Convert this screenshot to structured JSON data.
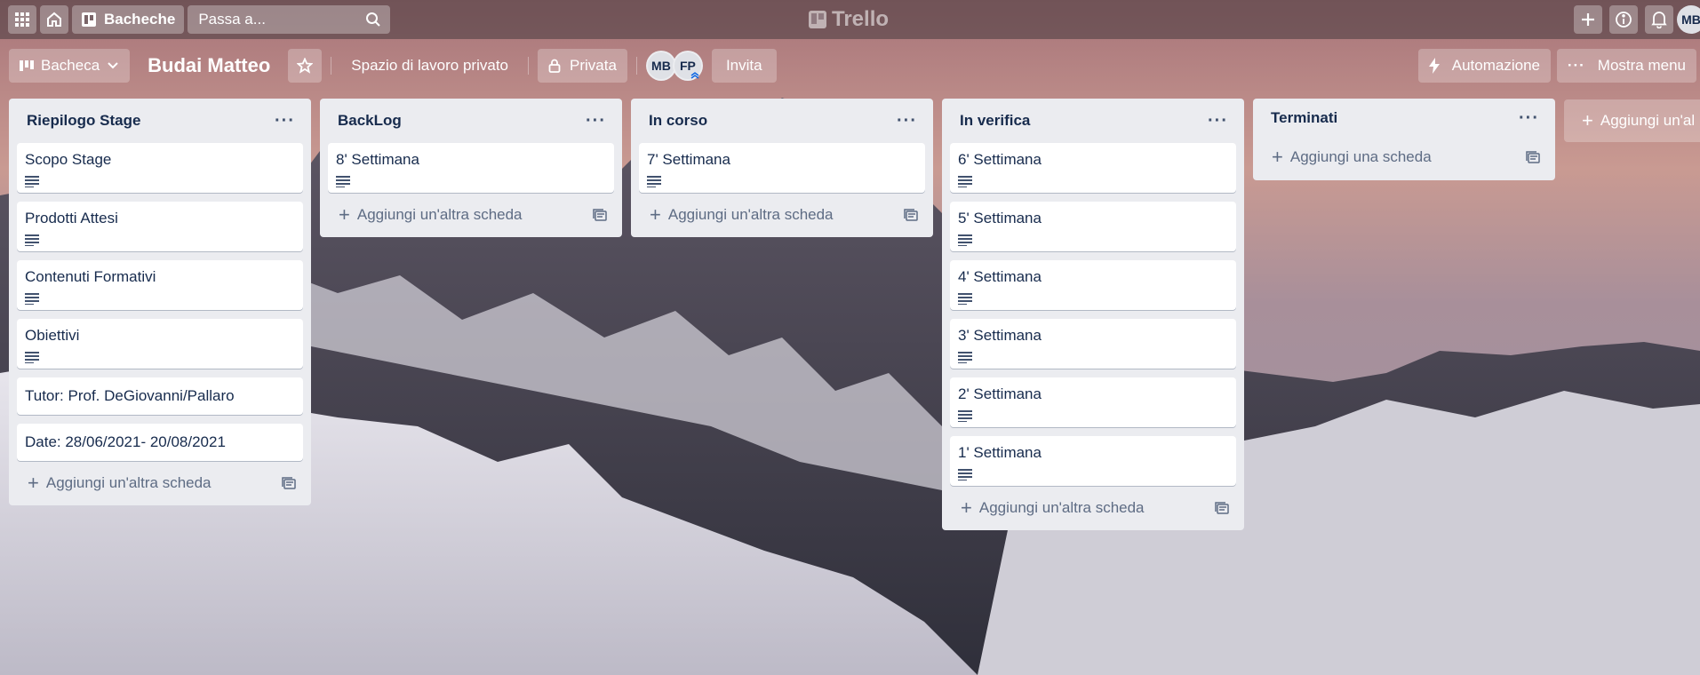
{
  "header": {
    "boards_label": "Bacheche",
    "search_placeholder": "Passa a...",
    "logo_text": "Trello",
    "user_initials": "MB"
  },
  "board": {
    "view_label": "Bacheca",
    "title": "Budai Matteo",
    "workspace_label": "Spazio di lavoro privato",
    "visibility_label": "Privata",
    "members": [
      "MB",
      "FP"
    ],
    "invite_label": "Invita",
    "automation_label": "Automazione",
    "menu_label": "Mostra menu"
  },
  "lists": [
    {
      "title": "Riepilogo Stage",
      "cards": [
        {
          "title": "Scopo Stage",
          "has_desc": true
        },
        {
          "title": "Prodotti Attesi",
          "has_desc": true
        },
        {
          "title": "Contenuti Formativi",
          "has_desc": true
        },
        {
          "title": "Obiettivi",
          "has_desc": true
        },
        {
          "title": "Tutor: Prof. DeGiovanni/Pallaro",
          "has_desc": false
        },
        {
          "title": "Date: 28/06/2021- 20/08/2021",
          "has_desc": false
        }
      ],
      "add_label": "Aggiungi un'altra scheda"
    },
    {
      "title": "BackLog",
      "cards": [
        {
          "title": "8' Settimana",
          "has_desc": true
        }
      ],
      "add_label": "Aggiungi un'altra scheda"
    },
    {
      "title": "In corso",
      "cards": [
        {
          "title": "7' Settimana",
          "has_desc": true
        }
      ],
      "add_label": "Aggiungi un'altra scheda"
    },
    {
      "title": "In verifica",
      "cards": [
        {
          "title": "6' Settimana",
          "has_desc": true
        },
        {
          "title": "5' Settimana",
          "has_desc": true
        },
        {
          "title": "4' Settimana",
          "has_desc": true
        },
        {
          "title": "3' Settimana",
          "has_desc": true
        },
        {
          "title": "2' Settimana",
          "has_desc": true
        },
        {
          "title": "1' Settimana",
          "has_desc": true
        }
      ],
      "add_label": "Aggiungi un'altra scheda"
    },
    {
      "title": "Terminati",
      "cards": [],
      "add_label": "Aggiungi una scheda"
    }
  ],
  "add_list_label": "Aggiungi un'al"
}
